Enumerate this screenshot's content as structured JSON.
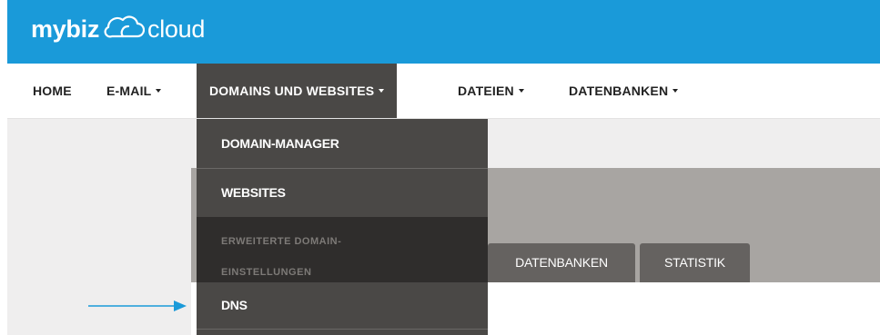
{
  "brand": {
    "name_bold": "mybiz",
    "name_light": "cloud",
    "icon": "cloud-icon",
    "color": "#1a9ad9"
  },
  "nav": {
    "home": "HOME",
    "email": "E-MAIL",
    "domains": "DOMAINS UND WEBSITES",
    "files": "DATEIEN",
    "databases": "DATENBANKEN"
  },
  "dropdown": {
    "domain_manager": "DOMAIN-MANAGER",
    "websites": "WEBSITES",
    "advanced_line1": "ERWEITERTE DOMAIN-",
    "advanced_line2": "EINSTELLUNGEN",
    "dns": "DNS"
  },
  "tabs": {
    "databases": "DATENBANKEN",
    "statistics": "STATISTIK"
  },
  "annotation": {
    "arrow_icon": "arrow-right-icon",
    "arrow_color": "#1a9ad9"
  },
  "colors": {
    "nav_active_bg": "#4a4846",
    "dropdown_bg": "#4a4846",
    "submenu_bg": "#2f2d2c",
    "banner_bg": "#a8a5a2",
    "tab_bg": "#656260"
  }
}
